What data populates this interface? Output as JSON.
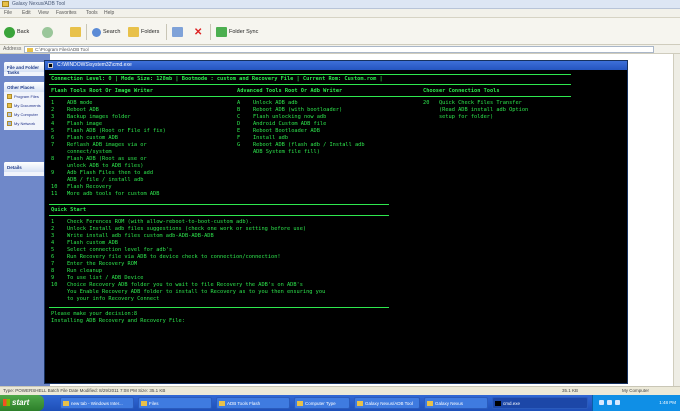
{
  "window": {
    "title": "Galaxy Nexus/ADB Tool"
  },
  "menu": {
    "items": [
      "File",
      "Edit",
      "View",
      "Favorites",
      "Tools",
      "Help"
    ]
  },
  "toolbar": {
    "back_label": "Back",
    "search_label": "Search",
    "folders_label": "Folders",
    "sync_label": "Folder Sync"
  },
  "address": {
    "label": "Address",
    "value": "C:\\Program Files\\ADB Tool"
  },
  "leftpane": {
    "box1_title": "File and Folder Tasks",
    "box2_title": "Other Places",
    "box2_items": [
      "Program Files",
      "My Documents",
      "My Computer",
      "My Network"
    ],
    "box3_title": "Details"
  },
  "console": {
    "title": "C:\\WINDOWS\\system32\\cmd.exe",
    "header": "Connection Level: 0 | Mode Size: 128mb | Bootmode : custom and Recovery File | Current Rom: Custom.rom |",
    "col1_title": "Flash Tools Root Or Image Writer",
    "col2_title": "Advanced Tools Root Or Adb Writer",
    "col3_title": "Chooser Connection Tools",
    "col1_lines": [
      "1    ADB mode",
      "2    Reboot ADB",
      "3    Backup images folder",
      "4    Flash image",
      "5    Flash ADB (Root or File if fix)",
      "6    Flash custom ADB",
      "7    Reflash ADB images via or",
      "     connect/system",
      "8    Flash ADB (Root as use or",
      "     unlock ADB to ADB files)",
      "9    Adb Flash Files then to add",
      "     ADB / file / install adb",
      "10   Flash Recovery",
      "11   More adb tools for custom ADB"
    ],
    "col2_lines": [
      "A    Unlock ADB adb",
      "B    Reboot ADB (with bootloader)",
      "C    Flash unlocking now adb",
      "D    Android Custom ADB file",
      "E    Reboot Bootloader ADB",
      "F    Install adb",
      "G    Reboot ADB (flash adb / Install adb",
      "     ADB System file fill)"
    ],
    "col3_lines": [
      "20   Quick Check Files Transfer",
      "     (Read ADB install adb Option",
      "     setup for folder)"
    ],
    "quick_title": "Quick Start",
    "quick_lines": [
      "1    Check Ferences ROM (with allow-reboot-to-boot-custom adb).",
      "2    Unlock Install adb files suggestions (check one work or setting before use)",
      "3    Write install adb files custom adb-ADB-ADB-ADB",
      "4    Flash custom ADB",
      "5    Select connection level for adb's",
      "6    Run Recovery file via ADB to device check to connection/connection!",
      "7    Enter the Recovery ROM",
      "8    Run cleanup",
      "9    To use list / ADB Device",
      "10   Choice Recovery ADB folder you to wait to file Recovery the ADB's on ADB's",
      "     You Enable Recovery ADB folder to install to Recovery as to you then ensuring you",
      "     to your info Recovery Connect"
    ],
    "prompt_lines": [
      "Please make your decision:8",
      "Installing ADB Recovery and Recovery File:"
    ]
  },
  "status": {
    "left": "Type: POWERSHELL Batch File Date Modified: 8/29/2011 7:08 PM Size: 35.1 KB",
    "middle": "35.1 KB",
    "right": "My Computer"
  },
  "taskbar": {
    "start_label": "start",
    "tasks": [
      "new tab - Windows Inter...",
      "Files",
      "ADB Tools Flash",
      "Computer Type",
      "Galaxy Nexus/ADB Tool",
      "Galaxy Nexus",
      "cmd.exe"
    ],
    "clock": "1:48 PM"
  }
}
